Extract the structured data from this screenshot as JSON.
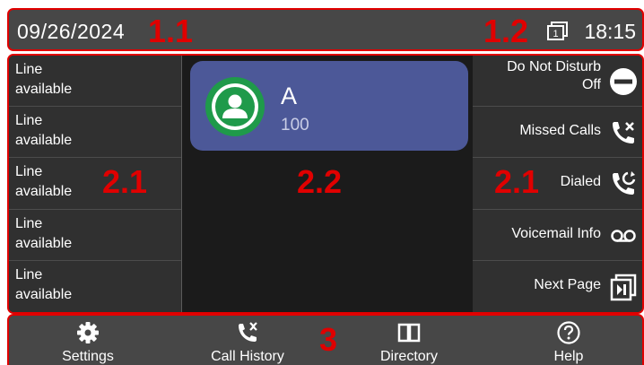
{
  "status_bar": {
    "date": "09/26/2024",
    "line_indicator": "1",
    "time": "18:15"
  },
  "line_keys": [
    {
      "line1": "Line",
      "line2": "available"
    },
    {
      "line1": "Line",
      "line2": "available"
    },
    {
      "line1": "Line",
      "line2": "available"
    },
    {
      "line1": "Line",
      "line2": "available"
    },
    {
      "line1": "Line",
      "line2": "available"
    }
  ],
  "feature_keys": [
    {
      "line1": "Do Not Disturb",
      "line2": "Off",
      "icon": "dnd-icon"
    },
    {
      "label": "Missed Calls",
      "icon": "missed-call-icon"
    },
    {
      "label": "Dialed",
      "icon": "dialed-call-icon"
    },
    {
      "label": "Voicemail Info",
      "icon": "voicemail-icon"
    },
    {
      "label": "Next Page",
      "icon": "next-page-icon"
    }
  ],
  "contact": {
    "name": "A",
    "number": "100"
  },
  "softkeys": [
    {
      "label": "Settings",
      "icon": "gear-icon"
    },
    {
      "label": "Call History",
      "icon": "call-history-icon"
    },
    {
      "label": "Directory",
      "icon": "book-icon"
    },
    {
      "label": "Help",
      "icon": "help-icon"
    }
  ],
  "annotations": {
    "status_date": "1.1",
    "status_right": "1.2",
    "left_keys": "2.1",
    "center": "2.2",
    "right_keys": "2.1",
    "softkey_bar": "3"
  },
  "colors": {
    "highlight_border": "#e00000",
    "contact_card": "#4c5898",
    "avatar_green": "#1f9a4a",
    "bar_bg": "#474747"
  }
}
